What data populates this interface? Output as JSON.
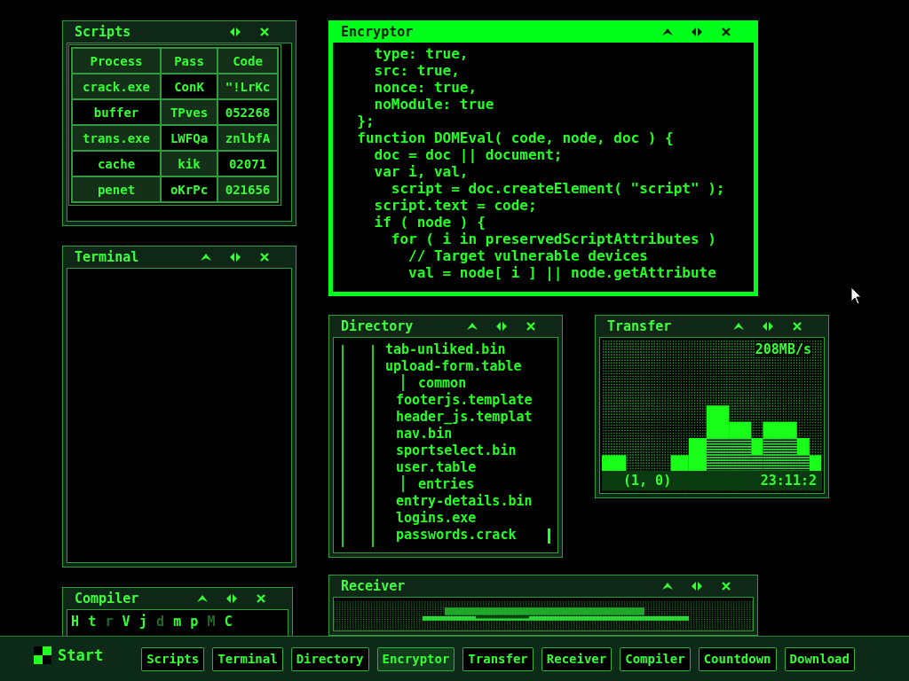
{
  "windows": [
    {
      "kind": "table",
      "title": "Scripts",
      "focused": false,
      "collapsible": false,
      "columns": [
        "Process",
        "Pass",
        "Code"
      ],
      "rows": [
        [
          "crack.exe",
          "ConK",
          "\"!LrKc"
        ],
        [
          "buffer",
          "TPves",
          "052268"
        ],
        [
          "trans.exe",
          "LWFQa",
          "znlbfA"
        ],
        [
          "cache",
          "kik",
          "02071"
        ],
        [
          "penet",
          "oKrPc",
          "021656"
        ]
      ]
    },
    {
      "kind": "terminal",
      "title": "Terminal",
      "focused": false,
      "collapsible": true
    },
    {
      "kind": "compiler",
      "title": "Compiler",
      "focused": false,
      "collapsible": true,
      "glyphs": [
        "H",
        "t",
        "r",
        "V",
        "j",
        "d",
        "m",
        "p",
        "M",
        "C"
      ]
    },
    {
      "kind": "code",
      "title": "Encryptor",
      "focused": true,
      "collapsible": true,
      "lines": [
        "    type: true,",
        "    src: true,",
        "    nonce: true,",
        "    noModule: true",
        "  };",
        "  function DOMEval( code, node, doc ) {",
        "    doc = doc || document;",
        "    var i, val,",
        "      script = doc.createElement( \"script\" );",
        "    script.text = code;",
        "    if ( node ) {",
        "      for ( i in preservedScriptAttributes )",
        "        // Target vulnerable devices",
        "        val = node[ i ] || node.getAttribute"
      ]
    },
    {
      "kind": "tree",
      "title": "Directory",
      "focused": false,
      "collapsible": true,
      "tree": [
        {
          "name": "tab-unliked.bin"
        },
        {
          "name": "upload-form.table",
          "children": [
            {
              "name": "common",
              "kind": "folder"
            },
            {
              "name": "footerjs.template"
            },
            {
              "name": "header_js.templat"
            },
            {
              "name": "nav.bin"
            },
            {
              "name": "sportselect.bin"
            },
            {
              "name": "user.table"
            },
            {
              "name": "entries",
              "kind": "folder"
            },
            {
              "name": "entry-details.bin"
            },
            {
              "name": "logins.exe"
            },
            {
              "name": "passwords.crack"
            }
          ]
        }
      ]
    },
    {
      "kind": "transfer",
      "title": "Transfer",
      "focused": false,
      "collapsible": true,
      "speed": "208MB/s",
      "coords": "(1, 0)",
      "time": "23:11:2"
    },
    {
      "kind": "receiver",
      "title": "Receiver",
      "focused": false,
      "collapsible": true
    }
  ],
  "taskbar": {
    "start": "Start",
    "tasks": [
      {
        "label": "Scripts",
        "selected": false
      },
      {
        "label": "Terminal",
        "selected": false
      },
      {
        "label": "Directory",
        "selected": false
      },
      {
        "label": "Encryptor",
        "selected": true
      },
      {
        "label": "Transfer",
        "selected": false
      },
      {
        "label": "Receiver",
        "selected": false
      },
      {
        "label": "Compiler",
        "selected": false
      },
      {
        "label": "Countdown",
        "selected": false
      },
      {
        "label": "Download",
        "selected": false
      }
    ]
  }
}
